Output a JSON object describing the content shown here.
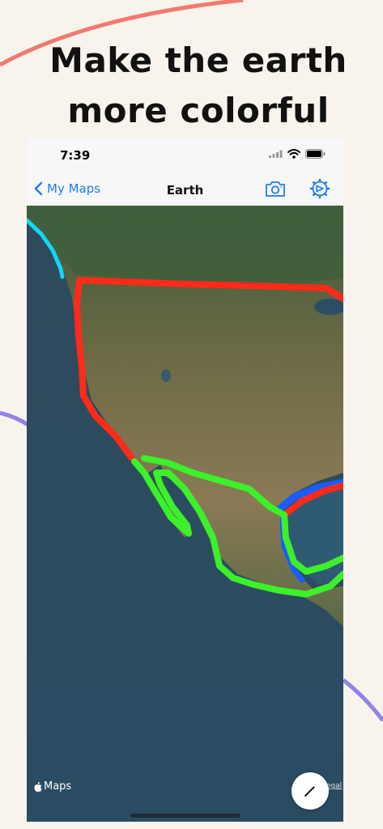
{
  "promo": {
    "headline_line1": "Make the earth",
    "headline_line2": "more colorful"
  },
  "status_bar": {
    "time": "7:39"
  },
  "navbar": {
    "back_label": "My Maps",
    "title": "Earth"
  },
  "map": {
    "attribution": "Maps",
    "legal": "Legal"
  },
  "icons": {
    "back": "chevron-left-icon",
    "camera": "camera-icon",
    "settings": "gear-icon",
    "fab": "pencil-icon",
    "signal": "cellular-signal-icon",
    "wifi": "wifi-icon",
    "battery": "battery-icon",
    "logo": "apple-logo-icon"
  },
  "colors": {
    "background": "#f8f3ec",
    "accent_blue": "#1f7cf6",
    "route_red": "#ff2a1a",
    "route_green": "#3cf02a",
    "route_blue": "#1a5cff",
    "route_cyan": "#10d8f5",
    "deco_coral": "#f07a6e",
    "deco_purple": "#8f82e8"
  }
}
